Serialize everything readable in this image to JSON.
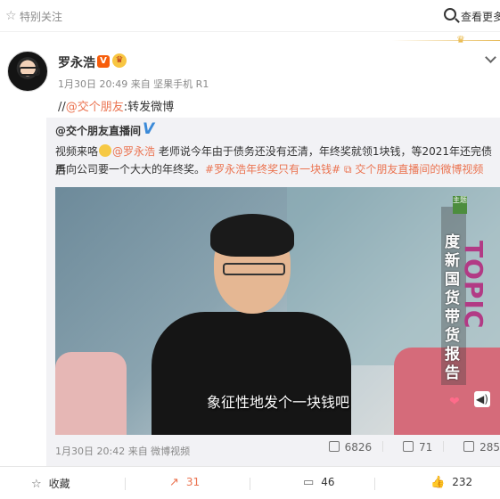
{
  "topbar": {
    "fav_label": "特别关注",
    "more_label": "查看更多"
  },
  "post": {
    "author": "罗永浩",
    "meta": "1月30日 20:49 来自 坚果手机 R1",
    "forward_prefix": "//",
    "forward_at": "@交个朋友",
    "forward_suffix": ":转发微博"
  },
  "retweet": {
    "author": "@交个朋友直播间",
    "text_a": "视频来咯",
    "text_at": "@罗永浩",
    "text_b": " 老师说今年由于债务还没有还清，年终奖就领1块钱，等2021年还完债后",
    "line2_a": "再向公司要一个大大的年终奖。",
    "line2_tag1": "#罗永浩年终奖只有一块钱#",
    "line2_tag2": "交个朋友直播间的微博视频",
    "video": {
      "topic_tag": "主题",
      "topic_text": "度新国货带货报告",
      "topic_en": "TOPIC",
      "subtitle": "象征性地发个一块钱吧"
    },
    "meta": "1月30日 20:42 来自 微博视频",
    "stats": {
      "reposts": "6826",
      "comments": "71",
      "likes": "285"
    }
  },
  "actions": {
    "favorite": "收藏",
    "repost": "31",
    "comment": "46",
    "like": "232"
  },
  "colors": {
    "link": "#eb7350",
    "verified_blue": "#3b8ad8",
    "retweet_bg": "#f2f2f5"
  }
}
